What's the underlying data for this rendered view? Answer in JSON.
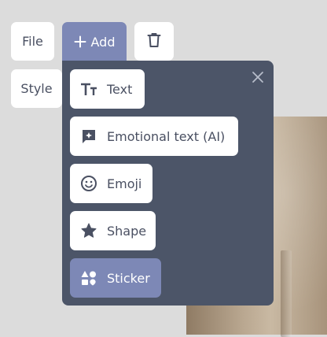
{
  "toolbar": {
    "file_label": "File",
    "add_label": "Add",
    "style_label": "Style",
    "delete_icon": "trash-icon"
  },
  "add_menu": {
    "close_icon": "close-icon",
    "items": [
      {
        "label": "Text",
        "icon": "text-size-icon",
        "active": false
      },
      {
        "label": "Emotional text (AI)",
        "icon": "ai-comment-icon",
        "active": false
      },
      {
        "label": "Emoji",
        "icon": "smiley-icon",
        "active": false
      },
      {
        "label": "Shape",
        "icon": "star-icon",
        "active": false
      },
      {
        "label": "Sticker",
        "icon": "shapes-icon",
        "active": true
      }
    ]
  },
  "colors": {
    "background": "#dcdcdc",
    "panel": "#4c5568",
    "accent": "#7d88b6",
    "text": "#4a5062"
  }
}
